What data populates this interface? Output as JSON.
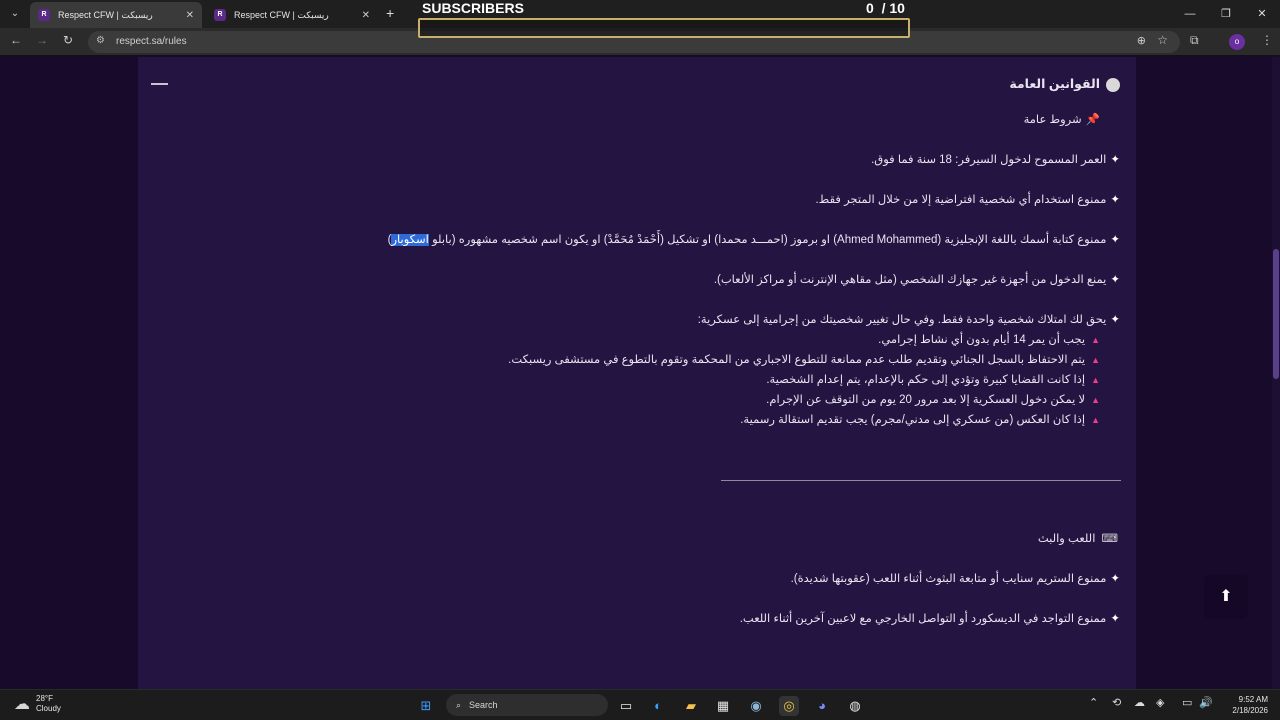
{
  "browser": {
    "tabs": [
      {
        "label": "Respect CFW | ريسبكت",
        "active": true
      },
      {
        "label": "Respect CFW | ريسبكت",
        "active": false
      }
    ],
    "url": "respect.sa/rules",
    "profile_initial": "o"
  },
  "overlay": {
    "title": "SUBSCRIBERS",
    "current": "0",
    "goal": "/ 10",
    "progress_fraction": 0
  },
  "rules": {
    "section_title": "القوانين العامة",
    "general_heading": "شروط عامة",
    "items": [
      "العمر المسموح لدخول السيرفر: 18 سنة فما فوق.",
      "ممنوع استخدام أي شخصية افتراضية إلا من خلال المتجر فقط.",
      "ممنوع كتابة أسمك باللغة الإنجليزية (Ahmed Mohammed) او برموز (احمـــد محمدا) او تشكيل (أَحْمَدْ مُحَمَّدْ) او يكون اسم شخصيه مشهوره (بابلو",
      "يمنع الدخول من أجهزة غير جهازك الشخصي (مثل مقاهي الإنترنت أو مراكز الألعاب).",
      "يحق لك امتلاك شخصية واحدة فقط. وفي حال تغيير شخصيتك من إجرامية إلى عسكرية:"
    ],
    "item3_highlight": "اسكوبار",
    "item3_tail": ")",
    "sub_items": [
      "يجب أن يمر 14 أيام بدون أي نشاط إجرامي.",
      "يتم الاحتفاظ بالسجل الجنائي وتقديم طلب عدم ممانعة للتطوع الاجباري من المحكمة وتقوم بالتطوع في مستشفى ريسبكت.",
      "إذا كانت القضايا كبيرة وتؤدي إلى حكم بالإعدام، يتم إعدام الشخصية.",
      "لا يمكن دخول العسكرية إلا بعد مرور 20 يوم من التوقف عن الإجرام.",
      "إذا كان العكس (من عسكري إلى مدني/مجرم) يجب تقديم استقالة رسمية."
    ],
    "gaming_heading": "اللعب والبث",
    "gaming_items": [
      "ممنوع الستريم سنايب أو متابعة البثوث أثناء اللعب (عقوبتها شديدة).",
      "ممنوع التواجد في الديسكورد أو التواصل الخارجي مع لاعبين آخرين أثناء اللعب."
    ]
  },
  "taskbar": {
    "weather_temp": "28°F",
    "weather_desc": "Cloudy",
    "search_label": "Search",
    "time": "9:52 AM",
    "date": "2/18/2026"
  },
  "icons": {
    "star_bullet": "✦",
    "sub_bullet": "▲",
    "pin": "📌",
    "scroll_top": "⬆"
  }
}
